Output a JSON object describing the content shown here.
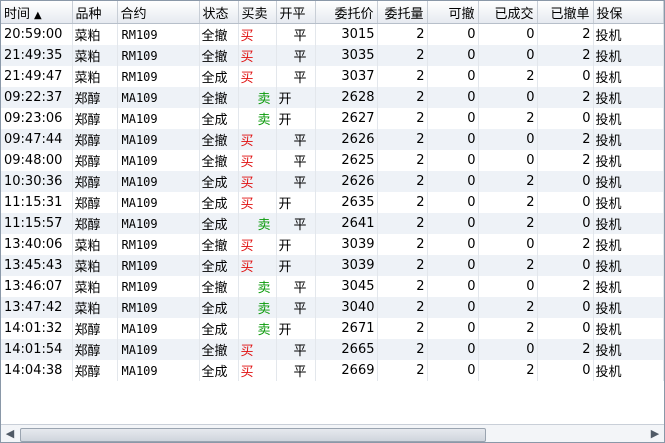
{
  "columns": [
    "时间",
    "品种",
    "合约",
    "状态",
    "买卖",
    "开平",
    "委托价",
    "委托量",
    "可撤",
    "已成交",
    "已撤单",
    "投保"
  ],
  "sort_indicator": "▲",
  "rows": [
    {
      "time": "20:59:00",
      "variety": "菜粕",
      "contract": "RM109",
      "status": "全撤",
      "bs": "买",
      "bs_type": "buy",
      "oc": "平",
      "price": "3015",
      "qty": "2",
      "cancelable": "0",
      "filled": "0",
      "cancelled": "2",
      "hedge": "投机"
    },
    {
      "time": "21:49:35",
      "variety": "菜粕",
      "contract": "RM109",
      "status": "全撤",
      "bs": "买",
      "bs_type": "buy",
      "oc": "平",
      "price": "3035",
      "qty": "2",
      "cancelable": "0",
      "filled": "0",
      "cancelled": "2",
      "hedge": "投机"
    },
    {
      "time": "21:49:47",
      "variety": "菜粕",
      "contract": "RM109",
      "status": "全成",
      "bs": "买",
      "bs_type": "buy",
      "oc": "平",
      "price": "3037",
      "qty": "2",
      "cancelable": "0",
      "filled": "2",
      "cancelled": "0",
      "hedge": "投机"
    },
    {
      "time": "09:22:37",
      "variety": "郑醇",
      "contract": "MA109",
      "status": "全撤",
      "bs": "卖",
      "bs_type": "sell",
      "oc": "开",
      "price": "2628",
      "qty": "2",
      "cancelable": "0",
      "filled": "0",
      "cancelled": "2",
      "hedge": "投机"
    },
    {
      "time": "09:23:06",
      "variety": "郑醇",
      "contract": "MA109",
      "status": "全成",
      "bs": "卖",
      "bs_type": "sell",
      "oc": "开",
      "price": "2627",
      "qty": "2",
      "cancelable": "0",
      "filled": "2",
      "cancelled": "0",
      "hedge": "投机"
    },
    {
      "time": "09:47:44",
      "variety": "郑醇",
      "contract": "MA109",
      "status": "全撤",
      "bs": "买",
      "bs_type": "buy",
      "oc": "平",
      "price": "2626",
      "qty": "2",
      "cancelable": "0",
      "filled": "0",
      "cancelled": "2",
      "hedge": "投机"
    },
    {
      "time": "09:48:00",
      "variety": "郑醇",
      "contract": "MA109",
      "status": "全撤",
      "bs": "买",
      "bs_type": "buy",
      "oc": "平",
      "price": "2625",
      "qty": "2",
      "cancelable": "0",
      "filled": "0",
      "cancelled": "2",
      "hedge": "投机"
    },
    {
      "time": "10:30:36",
      "variety": "郑醇",
      "contract": "MA109",
      "status": "全成",
      "bs": "买",
      "bs_type": "buy",
      "oc": "平",
      "price": "2626",
      "qty": "2",
      "cancelable": "0",
      "filled": "2",
      "cancelled": "0",
      "hedge": "投机"
    },
    {
      "time": "11:15:31",
      "variety": "郑醇",
      "contract": "MA109",
      "status": "全成",
      "bs": "买",
      "bs_type": "buy",
      "oc": "开",
      "price": "2635",
      "qty": "2",
      "cancelable": "0",
      "filled": "2",
      "cancelled": "0",
      "hedge": "投机"
    },
    {
      "time": "11:15:57",
      "variety": "郑醇",
      "contract": "MA109",
      "status": "全成",
      "bs": "卖",
      "bs_type": "sell",
      "oc": "平",
      "price": "2641",
      "qty": "2",
      "cancelable": "0",
      "filled": "2",
      "cancelled": "0",
      "hedge": "投机"
    },
    {
      "time": "13:40:06",
      "variety": "菜粕",
      "contract": "RM109",
      "status": "全撤",
      "bs": "买",
      "bs_type": "buy",
      "oc": "开",
      "price": "3039",
      "qty": "2",
      "cancelable": "0",
      "filled": "0",
      "cancelled": "2",
      "hedge": "投机"
    },
    {
      "time": "13:45:43",
      "variety": "菜粕",
      "contract": "RM109",
      "status": "全成",
      "bs": "买",
      "bs_type": "buy",
      "oc": "开",
      "price": "3039",
      "qty": "2",
      "cancelable": "0",
      "filled": "2",
      "cancelled": "0",
      "hedge": "投机"
    },
    {
      "time": "13:46:07",
      "variety": "菜粕",
      "contract": "RM109",
      "status": "全撤",
      "bs": "卖",
      "bs_type": "sell",
      "oc": "平",
      "price": "3045",
      "qty": "2",
      "cancelable": "0",
      "filled": "0",
      "cancelled": "2",
      "hedge": "投机"
    },
    {
      "time": "13:47:42",
      "variety": "菜粕",
      "contract": "RM109",
      "status": "全成",
      "bs": "卖",
      "bs_type": "sell",
      "oc": "平",
      "price": "3040",
      "qty": "2",
      "cancelable": "0",
      "filled": "2",
      "cancelled": "0",
      "hedge": "投机"
    },
    {
      "time": "14:01:32",
      "variety": "郑醇",
      "contract": "MA109",
      "status": "全成",
      "bs": "卖",
      "bs_type": "sell",
      "oc": "开",
      "price": "2671",
      "qty": "2",
      "cancelable": "0",
      "filled": "2",
      "cancelled": "0",
      "hedge": "投机"
    },
    {
      "time": "14:01:54",
      "variety": "郑醇",
      "contract": "MA109",
      "status": "全撤",
      "bs": "买",
      "bs_type": "buy",
      "oc": "平",
      "price": "2665",
      "qty": "2",
      "cancelable": "0",
      "filled": "0",
      "cancelled": "2",
      "hedge": "投机"
    },
    {
      "time": "14:04:38",
      "variety": "郑醇",
      "contract": "MA109",
      "status": "全成",
      "bs": "买",
      "bs_type": "buy",
      "oc": "平",
      "price": "2669",
      "qty": "2",
      "cancelable": "0",
      "filled": "2",
      "cancelled": "0",
      "hedge": "投机"
    }
  ],
  "scrollbar": {
    "left_arrow": "◀",
    "right_arrow": "▶",
    "left_arrow_icon": "chevron-left-icon",
    "right_arrow_icon": "chevron-right-icon"
  }
}
